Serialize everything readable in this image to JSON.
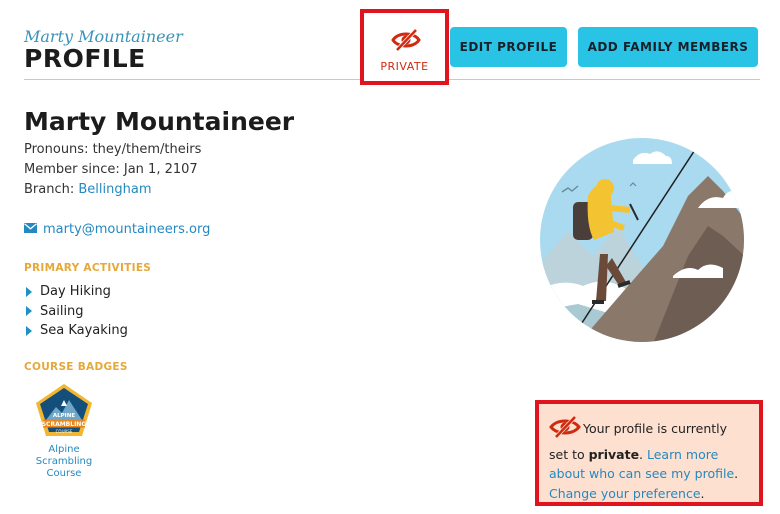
{
  "header": {
    "subtitle": "Marty Mountaineer",
    "title": "PROFILE"
  },
  "privacy_button": {
    "label": "PRIVATE",
    "icon": "eye-slash-icon"
  },
  "actions": {
    "edit_label": "EDIT PROFILE",
    "family_label": "ADD FAMILY MEMBERS"
  },
  "profile": {
    "name": "Marty Mountaineer",
    "pronouns": "Pronouns: they/them/theirs",
    "member_since": "Member since: Jan 1, 2107",
    "branch_prefix": "Branch: ",
    "branch": "Bellingham",
    "email": "marty@mountaineers.org"
  },
  "activities": {
    "label": "PRIMARY ACTIVITIES",
    "items": [
      "Day Hiking",
      "Sailing",
      "Sea Kayaking"
    ]
  },
  "badges": {
    "label": "COURSE BADGES",
    "items": [
      {
        "line1": "ALPINE",
        "line2": "SCRAMBLING",
        "line3": "COURSE",
        "caption_1": "Alpine",
        "caption_2": "Scrambling",
        "caption_3": "Course"
      }
    ]
  },
  "notice": {
    "text_1": "Your profile is currently set to ",
    "bold": "private",
    "text_2": ". ",
    "link_1": "Learn more about who can see my profile",
    "text_3": ". ",
    "link_2": "Change your preference",
    "text_4": "."
  },
  "colors": {
    "accent": "#29c3e6",
    "alert_border": "#e0141e",
    "alert_bg": "#fde0d0",
    "private_red": "#d02a10",
    "section_label": "#e5a83a",
    "link": "#2589c0"
  }
}
